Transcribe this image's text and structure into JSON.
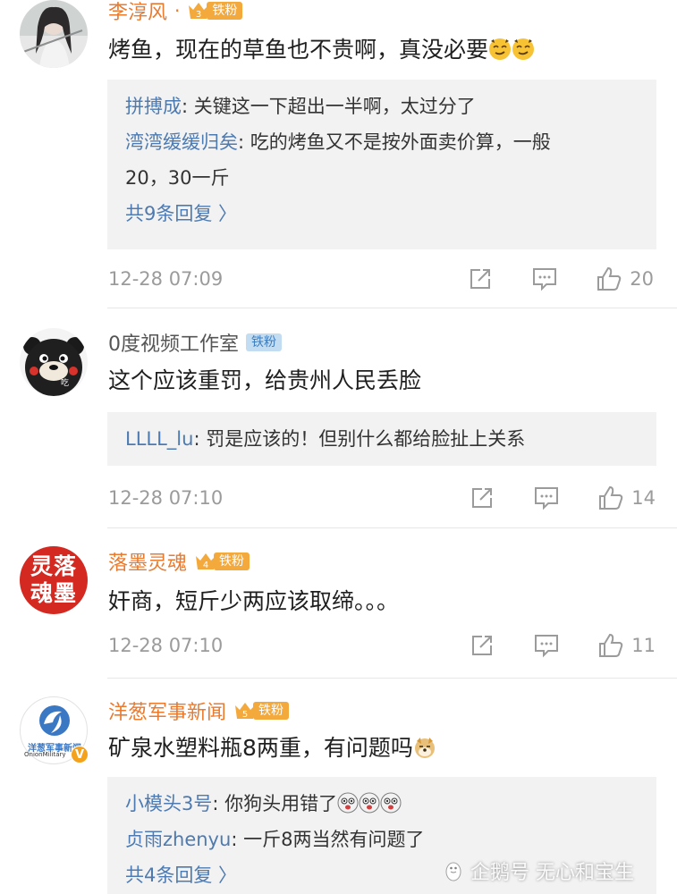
{
  "comments": [
    {
      "user": "李淳风",
      "dot": "·",
      "fan_level": "3",
      "fan_label": "铁粉",
      "text": "烤鱼，现在的草鱼也不贵啊，真没必要",
      "emoji": "smirk-emoji",
      "replies": [
        {
          "user": "拼搏成",
          "text": "关键这一下超出一半啊，太过分了"
        },
        {
          "user": "湾湾缓缓归矣",
          "text": "吃的烤鱼又不是按外面卖价算，一般",
          "text2": "20，30一斤"
        }
      ],
      "more": "共9条回复 〉",
      "time": "12-28 07:09",
      "likes": "20"
    },
    {
      "user": "0度视频工作室",
      "fan_label": "铁粉",
      "avatar_caption": "吃",
      "text": "这个应该重罚，给贵州人民丢脸",
      "replies": [
        {
          "user": "LLLL_lu",
          "text": "罚是应该的！但别什么都给脸扯上关系"
        }
      ],
      "time": "12-28 07:10",
      "likes": "14"
    },
    {
      "user": "落墨灵魂",
      "fan_level": "4",
      "fan_label": "铁粉",
      "avatar_text": "灵落魂墨",
      "text": "奸商，短斤少两应该取缔。。。",
      "time": "12-28 07:10",
      "likes": "11"
    },
    {
      "user": "洋葱军事新闻",
      "fan_level": "5",
      "fan_label": "铁粉",
      "avatar_line1": "洋葱军事新闻",
      "avatar_line2": "OnionMilitary",
      "avatar_badge": "V",
      "text": "矿泉水塑料瓶8两重，有问题吗",
      "emoji": "doge-emoji",
      "replies": [
        {
          "user": "小模头3号",
          "text": "你狗头用错了"
        },
        {
          "user": "贞雨zhenyu",
          "text": "一斤8两当然有问题了"
        }
      ],
      "more": "共4条回复 〉"
    }
  ],
  "watermark": "企鹅号 无心和宝生",
  "colors": {
    "accent": "#ea7a2e",
    "link": "#4d7ab0",
    "reply_bg": "#f2f2f2",
    "meta": "#9b9b9b"
  }
}
